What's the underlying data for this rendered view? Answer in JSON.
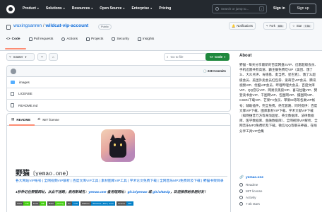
{
  "nav": {
    "items": [
      "Product",
      "Solutions",
      "Resources",
      "Open Source",
      "Enterprise",
      "Pricing"
    ],
    "search_placeholder": "Search or jump to...",
    "kbd": "/",
    "sign_in": "Sign in",
    "sign_up": "Sign up"
  },
  "repo": {
    "owner": "wuxingsanren",
    "separator": " / ",
    "name": "wildcat-vip-account",
    "visibility": "Public",
    "notifications": "Notifications",
    "fork_label": "Fork",
    "fork_count": "60k",
    "star_label": "Star",
    "star_count": "7.5k"
  },
  "tabs": [
    {
      "label": "Code",
      "active": true
    },
    {
      "label": "Pull requests"
    },
    {
      "label": "Actions"
    },
    {
      "label": "Projects"
    },
    {
      "label": "Security"
    },
    {
      "label": "Insights"
    }
  ],
  "toolbar": {
    "branch": "master",
    "goto_file": "Go to file",
    "code_button": "Code"
  },
  "files": {
    "commits": "238 Commits",
    "rows": [
      {
        "name": "images",
        "type": "folder"
      },
      {
        "name": "LICENSE",
        "type": "file"
      },
      {
        "name": "README.md",
        "type": "file"
      }
    ]
  },
  "readme": {
    "tab_readme": "README",
    "tab_license": "MIT license",
    "heading": "野猫",
    "heading_code": "〔yemao.one〕",
    "links": "各大网站VIP帐号 | 全网视频VIP解析 | 百度文库VIP工具 | 素材图库VIP工具 | 学术论文免费下载 | 全网音乐MP3免费听及下载 | 野猫书架目录",
    "notice_prefix": "1秒钟记住野猫网址，从此不迷路；启用新域名：",
    "notice_link1": "yemao.one",
    "notice_mid": " 备用短网址：",
    "notice_link2": "git.io/yemao",
    "notice_or": " 或 ",
    "notice_link3": "git.io/52vip",
    "notice_suffix": "，欢迎推荐给亲朋好友！",
    "shields": [
      {
        "label": "Stars",
        "value": "7.5k",
        "color": "#4c1"
      },
      {
        "label": "Forks",
        "value": "60k",
        "color": "#4c1"
      },
      {
        "label": "Build",
        "value": "passing",
        "color": "#4c1"
      },
      {
        "label": "Go",
        "value": "1.20",
        "color": "#007ec6"
      },
      {
        "label": "Platform",
        "value": "Windows | Mac | Linux",
        "color": "#007ec6"
      },
      {
        "label": "License",
        "value": "MIT",
        "color": "#007ec6"
      }
    ]
  },
  "about": {
    "title": "About",
    "description": "野猫 - 每天分享最新的百度网盘SVIP、迅雷超级会员、手机迅雷共有高速、霸王餐免费吃VIP（美团、饿了么、大众点评、肯德基、麦当劳、星巴克）、饿了么超级会员、美团外卖会员红包券、爱奇艺VIP会员、腾讯视频VIP、优酷VIP会员、哔哩哔哩大会员、百度文库VIP、QQ音乐VIP、网易云黑胶VIP、喜马拉雅VIP、樊登读书会VIP、千图网VIP、包图网VIP、摄图网VIP、CSDN下载VIP、芒果TV会员、苹果ID等等各类VIP帐号；辅助插件，完全免费，绝无套路，同时提供：百度文库VIP下载、图库素材VIP下载、学术文献VIP下载（知网维普万方等海淘超星、英文数据库、法律数据库、医学数据库、金融数据库）、全网视频VIP解析、全网音乐MP3免费听及下载，微信/QQ等聊天神器，在线分享工具VIP合集",
    "website": "yemao.one",
    "meta": [
      "Readme",
      "MIT license",
      "Activity",
      "7.5k stars"
    ]
  },
  "colors": {
    "nav_bg": "#24292f",
    "link": "#0969da",
    "code_button": "#1f883d",
    "tab_underline": "#fd8c73"
  }
}
